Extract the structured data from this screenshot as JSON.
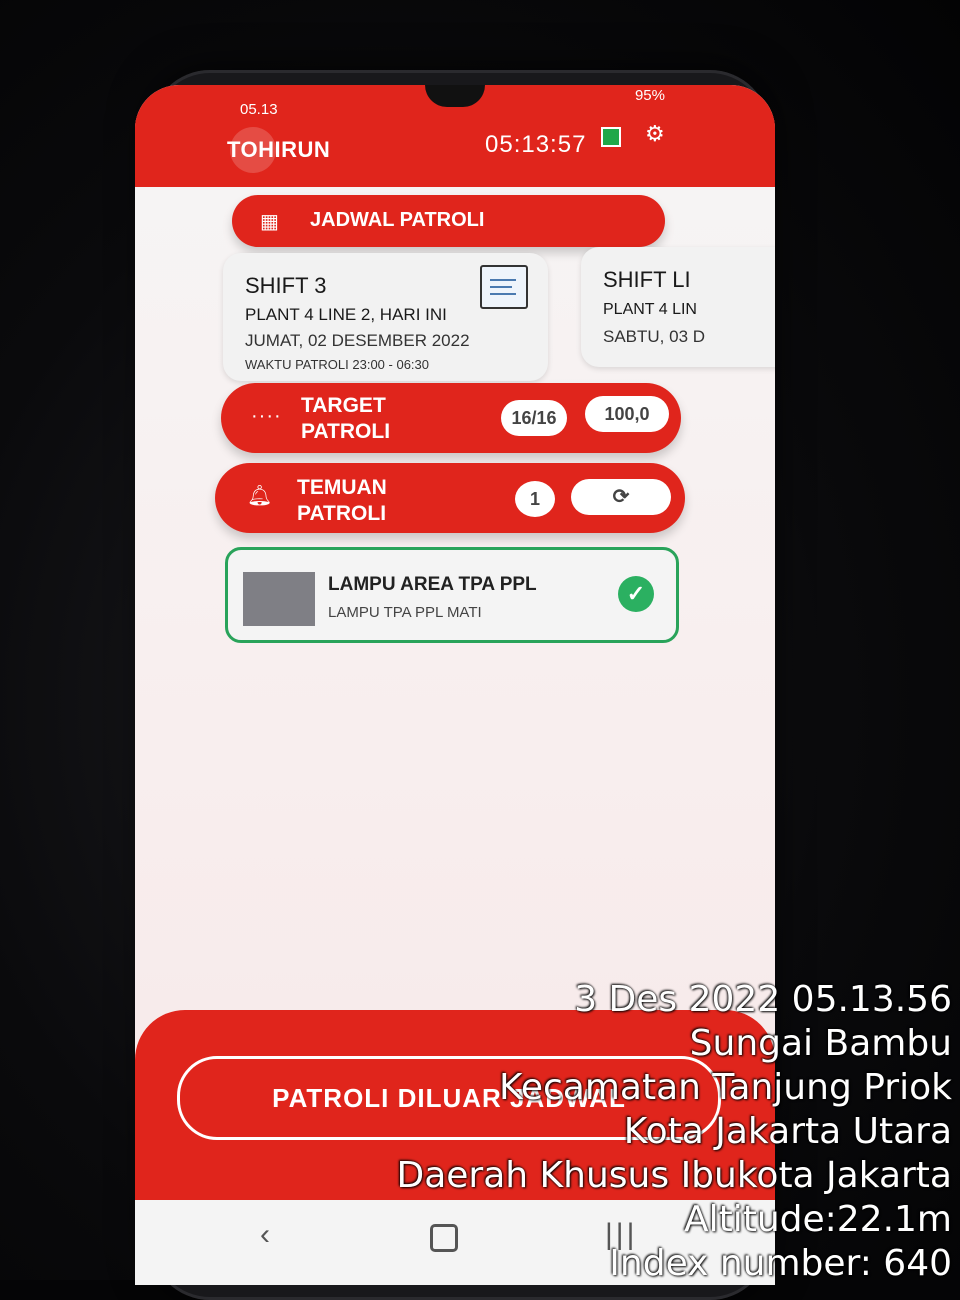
{
  "statusbar": {
    "time": "05.13",
    "battery": "95%"
  },
  "header": {
    "user": "TOHIRUN",
    "clock": "05:13:57"
  },
  "schedule_button": {
    "label": "JADWAL PATROLI"
  },
  "cards": [
    {
      "shift": "SHIFT 3",
      "location": "PLANT 4 LINE 2, HARI INI",
      "date": "JUMAT, 02 DESEMBER 2022",
      "time": "WAKTU PATROLI 23:00 - 06:30"
    },
    {
      "shift": "SHIFT LI",
      "location": "PLANT 4 LIN",
      "date": "SABTU, 03 D"
    }
  ],
  "target": {
    "label_line1": "TARGET",
    "label_line2": "PATROLI",
    "count": "16/16",
    "score": "100,0"
  },
  "finding": {
    "label_line1": "TEMUAN",
    "label_line2": "PATROLI",
    "count": "1"
  },
  "item": {
    "title": "LAMPU AREA TPA PPL",
    "subtitle": "LAMPU TPA PPL MATI",
    "status_icon": "check-icon"
  },
  "bottom_button": {
    "label": "PATROLI DILUAR JADWAL"
  },
  "stamp": {
    "datetime": "3 Des 2022 05.13.56",
    "line1": "Sungai Bambu",
    "line2": "Kecamatan Tanjung Priok",
    "line3": "Kota Jakarta Utara",
    "line4": "Daerah Khusus Ibukota Jakarta",
    "altitude": "Altitude:22.1m",
    "index": "Index number: 640"
  },
  "colors": {
    "accent": "#e0251c",
    "success": "#2bb061"
  }
}
